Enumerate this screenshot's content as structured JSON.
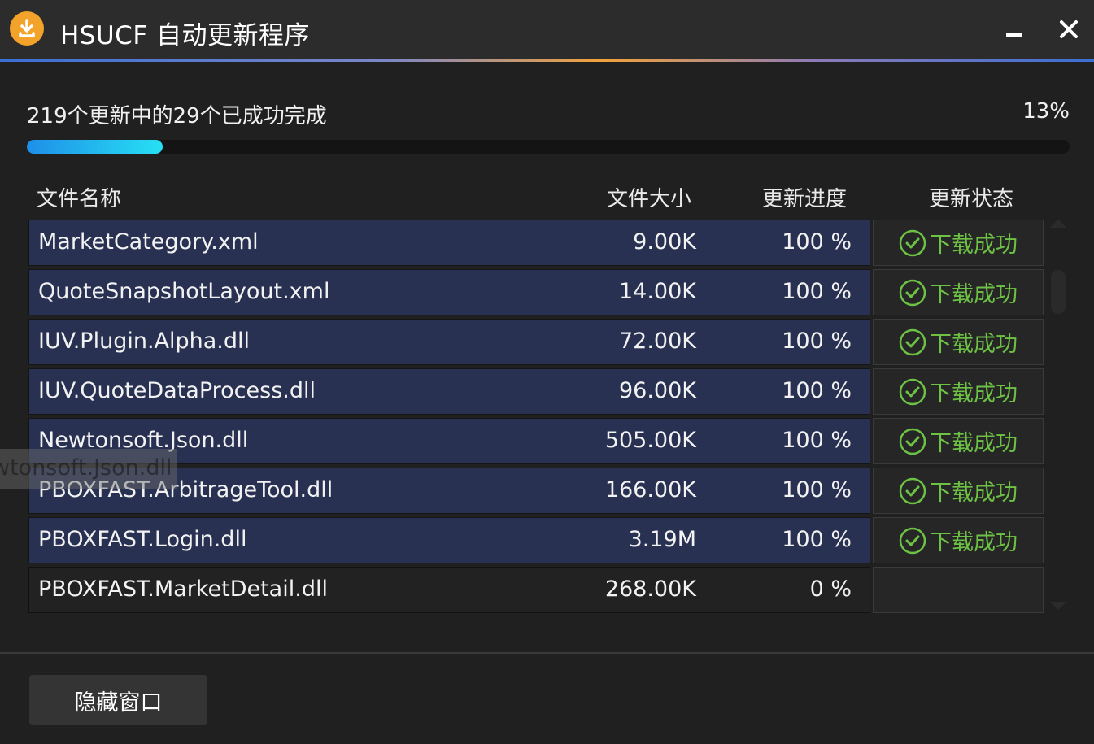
{
  "window": {
    "title": "HSUCF 自动更新程序"
  },
  "summary": {
    "text": "219个更新中的29个已成功完成",
    "percent_label": "13%",
    "percent": 13
  },
  "columns": {
    "name": "文件名称",
    "size": "文件大小",
    "progress": "更新进度",
    "status": "更新状态"
  },
  "files": [
    {
      "name": "MarketCategory.xml",
      "size": "9.00K",
      "progress": "100 %",
      "status": "下载成功"
    },
    {
      "name": "QuoteSnapshotLayout.xml",
      "size": "14.00K",
      "progress": "100 %",
      "status": "下载成功"
    },
    {
      "name": "IUV.Plugin.Alpha.dll",
      "size": "72.00K",
      "progress": "100 %",
      "status": "下载成功"
    },
    {
      "name": "IUV.QuoteDataProcess.dll",
      "size": "96.00K",
      "progress": "100 %",
      "status": "下载成功"
    },
    {
      "name": "Newtonsoft.Json.dll",
      "size": "505.00K",
      "progress": "100 %",
      "status": "下载成功"
    },
    {
      "name": "PBOXFAST.ArbitrageTool.dll",
      "size": "166.00K",
      "progress": "100 %",
      "status": "下载成功"
    },
    {
      "name": "PBOXFAST.Login.dll",
      "size": "3.19M",
      "progress": "100 %",
      "status": "下载成功"
    },
    {
      "name": "PBOXFAST.MarketDetail.dll",
      "size": "268.00K",
      "progress": "0 %",
      "status": ""
    }
  ],
  "drag_ghost": {
    "text": "wtonsoft.Json.dll"
  },
  "footer": {
    "hide_button": "隐藏窗口"
  },
  "colors": {
    "accent_orange": "#f3a22a",
    "success_green": "#6dc144",
    "row_blue": "#293152",
    "progress_cyan": "#27e0f4"
  }
}
